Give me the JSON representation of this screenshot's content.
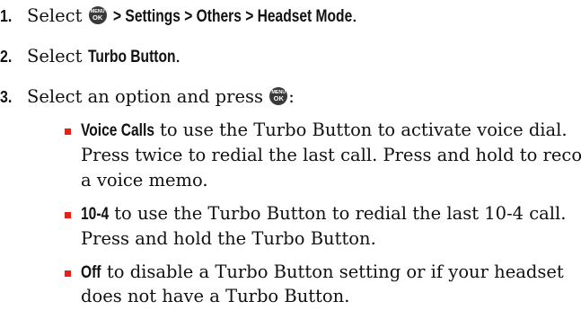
{
  "steps": [
    {
      "number": "1.",
      "prefix": "Select",
      "path": "> Settings > Others > Headset Mode",
      "suffix": "."
    },
    {
      "number": "2.",
      "prefix": "Select",
      "target": "Turbo Button",
      "suffix": "."
    },
    {
      "number": "3.",
      "text": "Select an option and press",
      "suffix": ":"
    }
  ],
  "menu_key": {
    "top": "MENU",
    "bottom": "OK",
    "icon": "menu-ok-key-icon"
  },
  "options": [
    {
      "keyword": "Voice Calls",
      "lines": [
        "to use the Turbo Button to activate voice dial.",
        "Press twice to redial the last call. Press and hold to record",
        "a voice memo."
      ]
    },
    {
      "keyword": "10-4",
      "lines": [
        "to use the Turbo Button to redial the last 10-4 call.",
        "Press and hold the Turbo Button."
      ]
    },
    {
      "keyword": "Off",
      "lines": [
        "to disable a Turbo Button setting or if your headset",
        "does not have a Turbo Button."
      ]
    }
  ],
  "colors": {
    "bullet": "#e2231a",
    "text": "#111111",
    "key_bg": "#3a3a3a"
  }
}
